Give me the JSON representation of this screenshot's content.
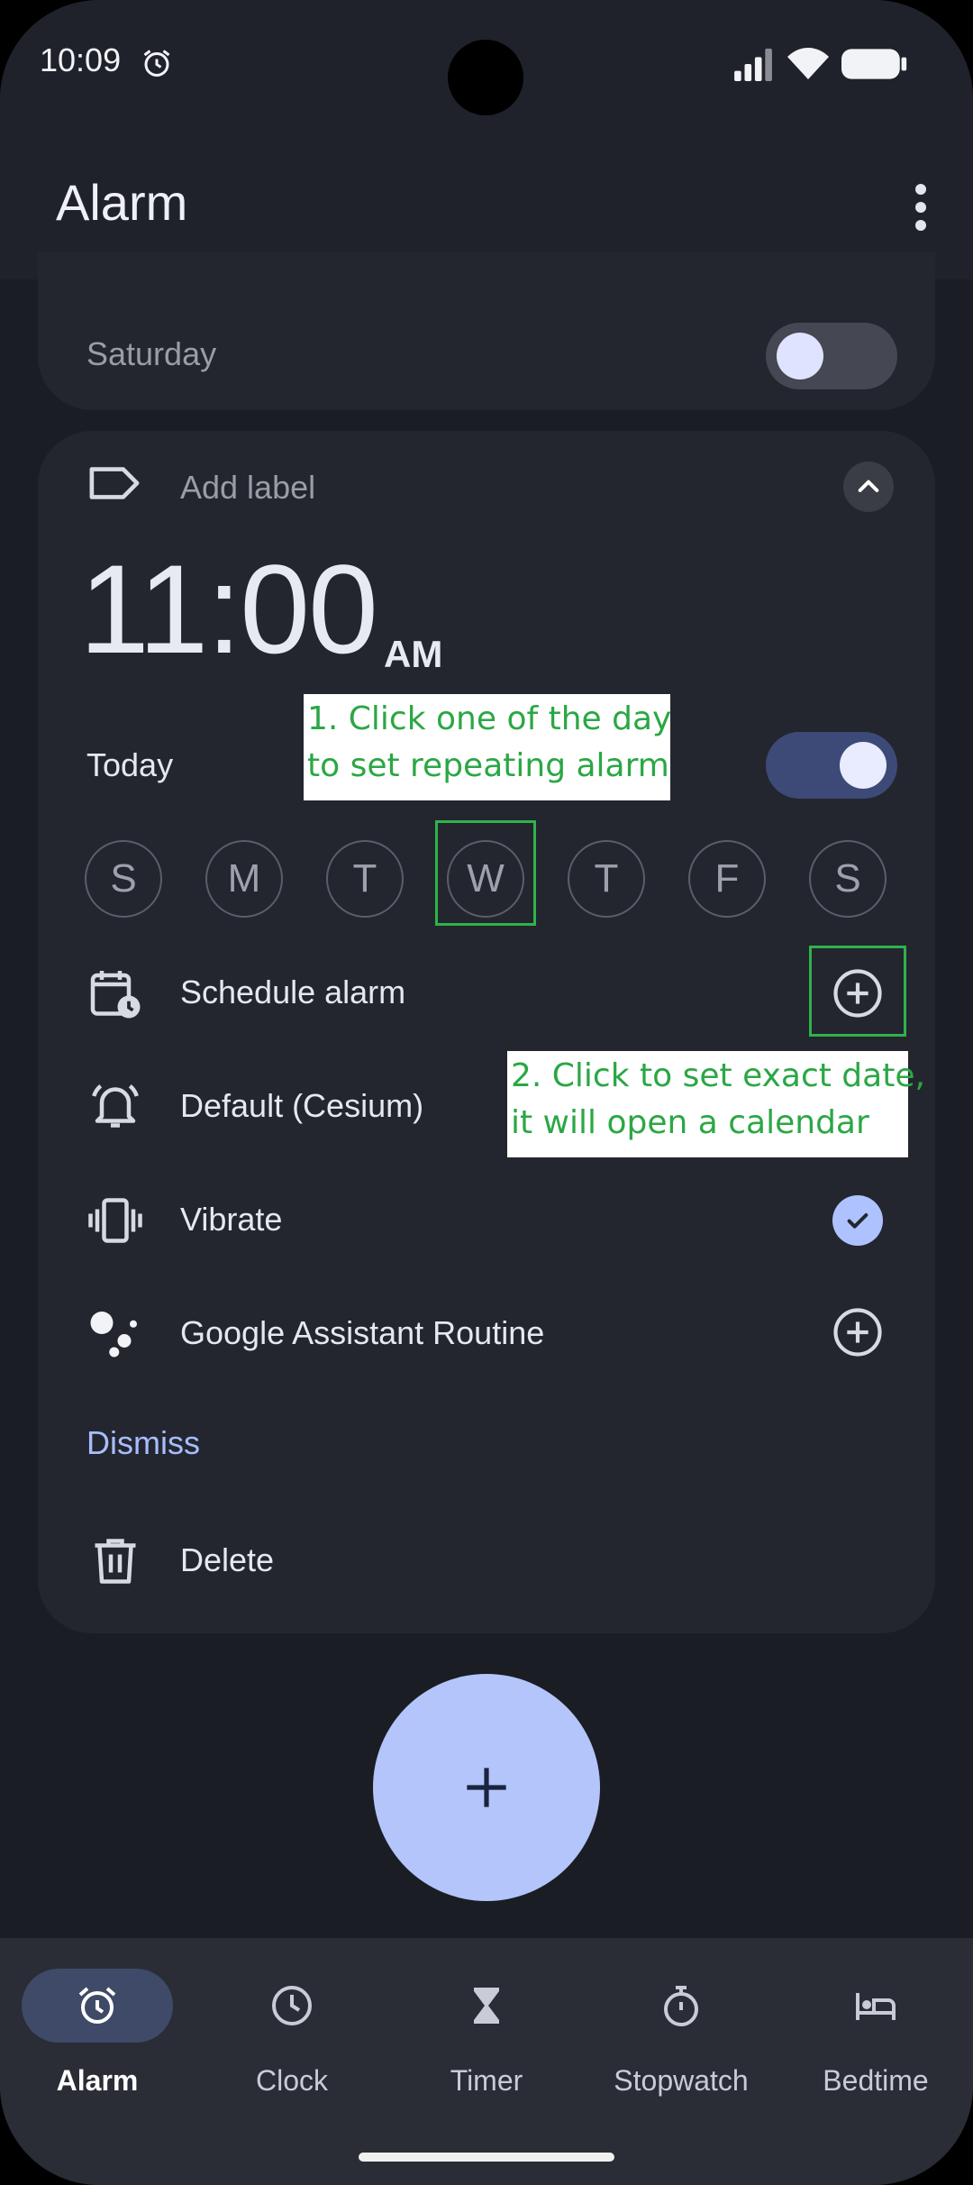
{
  "status": {
    "time": "10:09"
  },
  "app_bar": {
    "title": "Alarm"
  },
  "prev_alarm": {
    "day_label": "Saturday"
  },
  "alarm": {
    "label_placeholder": "Add label",
    "time": "11:00",
    "ampm": "AM",
    "day_summary": "Today",
    "days": [
      "S",
      "M",
      "T",
      "W",
      "T",
      "F",
      "S"
    ],
    "schedule_label": "Schedule alarm",
    "ringtone_label": "Default (Cesium)",
    "vibrate_label": "Vibrate",
    "routine_label": "Google Assistant Routine",
    "dismiss_label": "Dismiss",
    "delete_label": "Delete"
  },
  "annotations": {
    "step1_line1": "1. Click one of the day",
    "step1_line2": "to set repeating alarm",
    "step2_line1": "2. Click to set exact date,",
    "step2_line2": "it will open a calendar"
  },
  "nav": [
    {
      "label": "Alarm",
      "icon": "alarm-icon"
    },
    {
      "label": "Clock",
      "icon": "clock-icon"
    },
    {
      "label": "Timer",
      "icon": "hourglass-icon"
    },
    {
      "label": "Stopwatch",
      "icon": "stopwatch-icon"
    },
    {
      "label": "Bedtime",
      "icon": "bed-icon"
    }
  ],
  "colors": {
    "background": "#1b1d24",
    "card": "#23262e",
    "accent": "#b3c5fb",
    "annotation": "#2db34a"
  }
}
